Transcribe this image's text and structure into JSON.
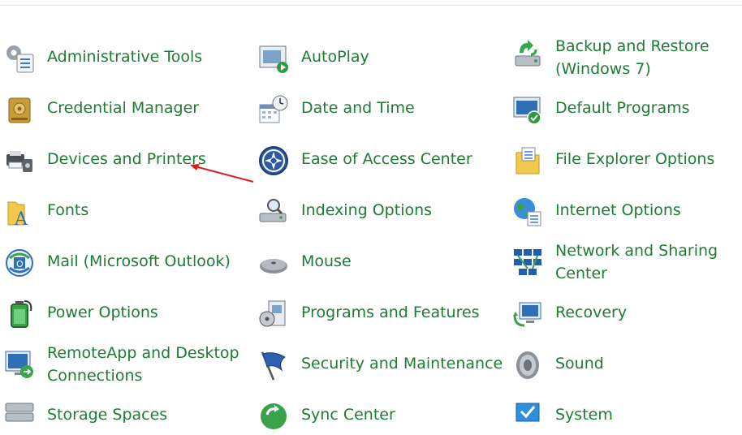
{
  "items": [
    {
      "label": "Administrative Tools",
      "icon": "admin-tools-icon"
    },
    {
      "label": "AutoPlay",
      "icon": "autoplay-icon"
    },
    {
      "label": "Backup and Restore (Windows 7)",
      "label_lines": [
        "Backup and Restore",
        "(Windows 7)"
      ],
      "icon": "backup-restore-icon"
    },
    {
      "label": "Credential Manager",
      "icon": "credential-manager-icon"
    },
    {
      "label": "Date and Time",
      "icon": "date-time-icon"
    },
    {
      "label": "Default Programs",
      "icon": "default-programs-icon"
    },
    {
      "label": "Devices and Printers",
      "icon": "devices-printers-icon"
    },
    {
      "label": "Ease of Access Center",
      "icon": "ease-of-access-icon"
    },
    {
      "label": "File Explorer Options",
      "icon": "file-explorer-options-icon"
    },
    {
      "label": "Fonts",
      "icon": "fonts-icon"
    },
    {
      "label": "Indexing Options",
      "icon": "indexing-options-icon"
    },
    {
      "label": "Internet Options",
      "icon": "internet-options-icon"
    },
    {
      "label": "Mail (Microsoft Outlook)",
      "icon": "mail-icon"
    },
    {
      "label": "Mouse",
      "icon": "mouse-icon"
    },
    {
      "label": "Network and Sharing Center",
      "label_lines": [
        "Network and Sharing",
        "Center"
      ],
      "icon": "network-sharing-icon"
    },
    {
      "label": "Power Options",
      "icon": "power-options-icon"
    },
    {
      "label": "Programs and Features",
      "icon": "programs-features-icon"
    },
    {
      "label": "Recovery",
      "icon": "recovery-icon"
    },
    {
      "label": "RemoteApp and Desktop Connections",
      "label_lines": [
        "RemoteApp and Desktop",
        "Connections"
      ],
      "icon": "remoteapp-icon"
    },
    {
      "label": "Security and Maintenance",
      "icon": "security-maintenance-icon"
    },
    {
      "label": "Sound",
      "icon": "sound-icon"
    },
    {
      "label": "Storage Spaces",
      "icon": "storage-spaces-icon"
    },
    {
      "label": "Sync Center",
      "icon": "sync-center-icon"
    },
    {
      "label": "System",
      "icon": "system-icon"
    }
  ],
  "colors": {
    "link_text": "#1e7b34",
    "annotation_arrow": "#d9201f"
  }
}
